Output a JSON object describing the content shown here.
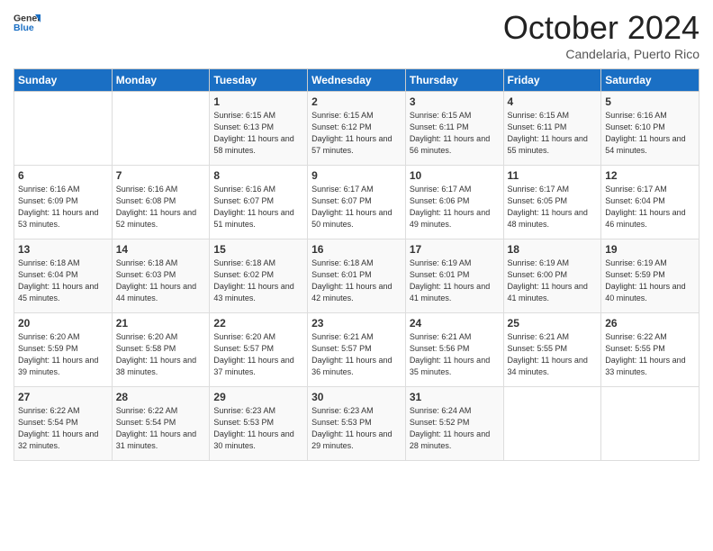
{
  "header": {
    "logo_line1": "General",
    "logo_line2": "Blue",
    "month": "October 2024",
    "location": "Candelaria, Puerto Rico"
  },
  "days_of_week": [
    "Sunday",
    "Monday",
    "Tuesday",
    "Wednesday",
    "Thursday",
    "Friday",
    "Saturday"
  ],
  "weeks": [
    [
      {
        "day": "",
        "sunrise": "",
        "sunset": "",
        "daylight": ""
      },
      {
        "day": "",
        "sunrise": "",
        "sunset": "",
        "daylight": ""
      },
      {
        "day": "1",
        "sunrise": "Sunrise: 6:15 AM",
        "sunset": "Sunset: 6:13 PM",
        "daylight": "Daylight: 11 hours and 58 minutes."
      },
      {
        "day": "2",
        "sunrise": "Sunrise: 6:15 AM",
        "sunset": "Sunset: 6:12 PM",
        "daylight": "Daylight: 11 hours and 57 minutes."
      },
      {
        "day": "3",
        "sunrise": "Sunrise: 6:15 AM",
        "sunset": "Sunset: 6:11 PM",
        "daylight": "Daylight: 11 hours and 56 minutes."
      },
      {
        "day": "4",
        "sunrise": "Sunrise: 6:15 AM",
        "sunset": "Sunset: 6:11 PM",
        "daylight": "Daylight: 11 hours and 55 minutes."
      },
      {
        "day": "5",
        "sunrise": "Sunrise: 6:16 AM",
        "sunset": "Sunset: 6:10 PM",
        "daylight": "Daylight: 11 hours and 54 minutes."
      }
    ],
    [
      {
        "day": "6",
        "sunrise": "Sunrise: 6:16 AM",
        "sunset": "Sunset: 6:09 PM",
        "daylight": "Daylight: 11 hours and 53 minutes."
      },
      {
        "day": "7",
        "sunrise": "Sunrise: 6:16 AM",
        "sunset": "Sunset: 6:08 PM",
        "daylight": "Daylight: 11 hours and 52 minutes."
      },
      {
        "day": "8",
        "sunrise": "Sunrise: 6:16 AM",
        "sunset": "Sunset: 6:07 PM",
        "daylight": "Daylight: 11 hours and 51 minutes."
      },
      {
        "day": "9",
        "sunrise": "Sunrise: 6:17 AM",
        "sunset": "Sunset: 6:07 PM",
        "daylight": "Daylight: 11 hours and 50 minutes."
      },
      {
        "day": "10",
        "sunrise": "Sunrise: 6:17 AM",
        "sunset": "Sunset: 6:06 PM",
        "daylight": "Daylight: 11 hours and 49 minutes."
      },
      {
        "day": "11",
        "sunrise": "Sunrise: 6:17 AM",
        "sunset": "Sunset: 6:05 PM",
        "daylight": "Daylight: 11 hours and 48 minutes."
      },
      {
        "day": "12",
        "sunrise": "Sunrise: 6:17 AM",
        "sunset": "Sunset: 6:04 PM",
        "daylight": "Daylight: 11 hours and 46 minutes."
      }
    ],
    [
      {
        "day": "13",
        "sunrise": "Sunrise: 6:18 AM",
        "sunset": "Sunset: 6:04 PM",
        "daylight": "Daylight: 11 hours and 45 minutes."
      },
      {
        "day": "14",
        "sunrise": "Sunrise: 6:18 AM",
        "sunset": "Sunset: 6:03 PM",
        "daylight": "Daylight: 11 hours and 44 minutes."
      },
      {
        "day": "15",
        "sunrise": "Sunrise: 6:18 AM",
        "sunset": "Sunset: 6:02 PM",
        "daylight": "Daylight: 11 hours and 43 minutes."
      },
      {
        "day": "16",
        "sunrise": "Sunrise: 6:18 AM",
        "sunset": "Sunset: 6:01 PM",
        "daylight": "Daylight: 11 hours and 42 minutes."
      },
      {
        "day": "17",
        "sunrise": "Sunrise: 6:19 AM",
        "sunset": "Sunset: 6:01 PM",
        "daylight": "Daylight: 11 hours and 41 minutes."
      },
      {
        "day": "18",
        "sunrise": "Sunrise: 6:19 AM",
        "sunset": "Sunset: 6:00 PM",
        "daylight": "Daylight: 11 hours and 41 minutes."
      },
      {
        "day": "19",
        "sunrise": "Sunrise: 6:19 AM",
        "sunset": "Sunset: 5:59 PM",
        "daylight": "Daylight: 11 hours and 40 minutes."
      }
    ],
    [
      {
        "day": "20",
        "sunrise": "Sunrise: 6:20 AM",
        "sunset": "Sunset: 5:59 PM",
        "daylight": "Daylight: 11 hours and 39 minutes."
      },
      {
        "day": "21",
        "sunrise": "Sunrise: 6:20 AM",
        "sunset": "Sunset: 5:58 PM",
        "daylight": "Daylight: 11 hours and 38 minutes."
      },
      {
        "day": "22",
        "sunrise": "Sunrise: 6:20 AM",
        "sunset": "Sunset: 5:57 PM",
        "daylight": "Daylight: 11 hours and 37 minutes."
      },
      {
        "day": "23",
        "sunrise": "Sunrise: 6:21 AM",
        "sunset": "Sunset: 5:57 PM",
        "daylight": "Daylight: 11 hours and 36 minutes."
      },
      {
        "day": "24",
        "sunrise": "Sunrise: 6:21 AM",
        "sunset": "Sunset: 5:56 PM",
        "daylight": "Daylight: 11 hours and 35 minutes."
      },
      {
        "day": "25",
        "sunrise": "Sunrise: 6:21 AM",
        "sunset": "Sunset: 5:55 PM",
        "daylight": "Daylight: 11 hours and 34 minutes."
      },
      {
        "day": "26",
        "sunrise": "Sunrise: 6:22 AM",
        "sunset": "Sunset: 5:55 PM",
        "daylight": "Daylight: 11 hours and 33 minutes."
      }
    ],
    [
      {
        "day": "27",
        "sunrise": "Sunrise: 6:22 AM",
        "sunset": "Sunset: 5:54 PM",
        "daylight": "Daylight: 11 hours and 32 minutes."
      },
      {
        "day": "28",
        "sunrise": "Sunrise: 6:22 AM",
        "sunset": "Sunset: 5:54 PM",
        "daylight": "Daylight: 11 hours and 31 minutes."
      },
      {
        "day": "29",
        "sunrise": "Sunrise: 6:23 AM",
        "sunset": "Sunset: 5:53 PM",
        "daylight": "Daylight: 11 hours and 30 minutes."
      },
      {
        "day": "30",
        "sunrise": "Sunrise: 6:23 AM",
        "sunset": "Sunset: 5:53 PM",
        "daylight": "Daylight: 11 hours and 29 minutes."
      },
      {
        "day": "31",
        "sunrise": "Sunrise: 6:24 AM",
        "sunset": "Sunset: 5:52 PM",
        "daylight": "Daylight: 11 hours and 28 minutes."
      },
      {
        "day": "",
        "sunrise": "",
        "sunset": "",
        "daylight": ""
      },
      {
        "day": "",
        "sunrise": "",
        "sunset": "",
        "daylight": ""
      }
    ]
  ]
}
